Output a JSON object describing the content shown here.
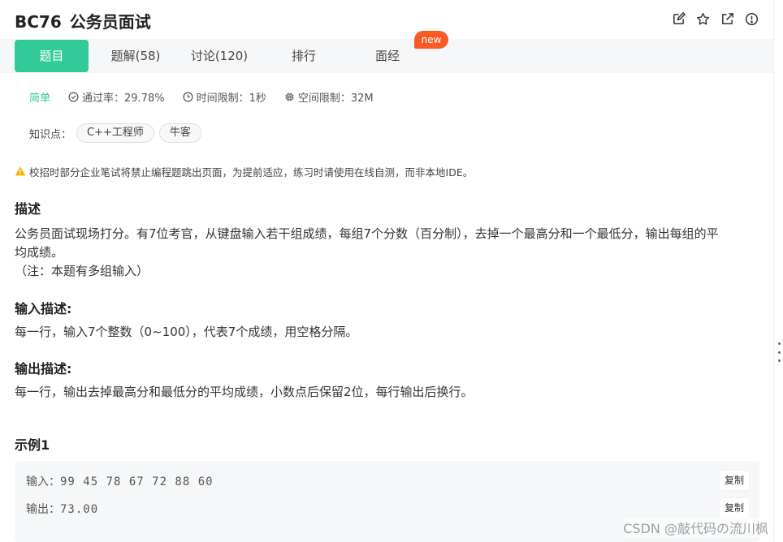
{
  "header": {
    "problem_id": "BC76",
    "problem_title": "公务员面试",
    "icons": [
      "edit-icon",
      "star-icon",
      "share-icon",
      "report-icon"
    ]
  },
  "tabs": [
    {
      "label": "题目",
      "active": true
    },
    {
      "label": "题解(58)",
      "active": false
    },
    {
      "label": "讨论(120)",
      "active": false
    },
    {
      "label": "排行",
      "active": false
    },
    {
      "label": "面经",
      "active": false,
      "badge": "new"
    }
  ],
  "meta": {
    "difficulty": "简单",
    "pass_rate": "通过率：29.78%",
    "time_limit": "时间限制：1秒",
    "memory_limit": "空间限制：32M"
  },
  "knowledge": {
    "label": "知识点：",
    "tags": [
      "C++工程师",
      "牛客"
    ]
  },
  "notice": "校招时部分企业笔试将禁止编程题跳出页面，为提前适应，练习时请使用在线自测，而非本地IDE。",
  "description": {
    "heading": "描述",
    "line1": "公务员面试现场打分。有7位考官，从键盘输入若干组成绩，每组7个分数（百分制），去掉一个最高分和一个最低分，输出每组的平",
    "line2": "均成绩。",
    "note": "（注：本题有多组输入）"
  },
  "input_desc": {
    "heading": "输入描述:",
    "text": "每一行，输入7个整数（0~100），代表7个成绩，用空格分隔。"
  },
  "output_desc": {
    "heading": "输出描述:",
    "text": "每一行，输出去掉最高分和最低分的平均成绩，小数点后保留2位，每行输出后换行。"
  },
  "example": {
    "heading": "示例1",
    "input_label": "输入：",
    "input_value": "99 45 78 67 72 88 60",
    "output_label": "输出：",
    "output_value": "73.00",
    "copy_label": "复制"
  },
  "watermark": "CSDN @敲代码の流川枫",
  "colors": {
    "accent": "#32ca99",
    "badge": "#fa5a24",
    "warning": "#f0b400"
  }
}
